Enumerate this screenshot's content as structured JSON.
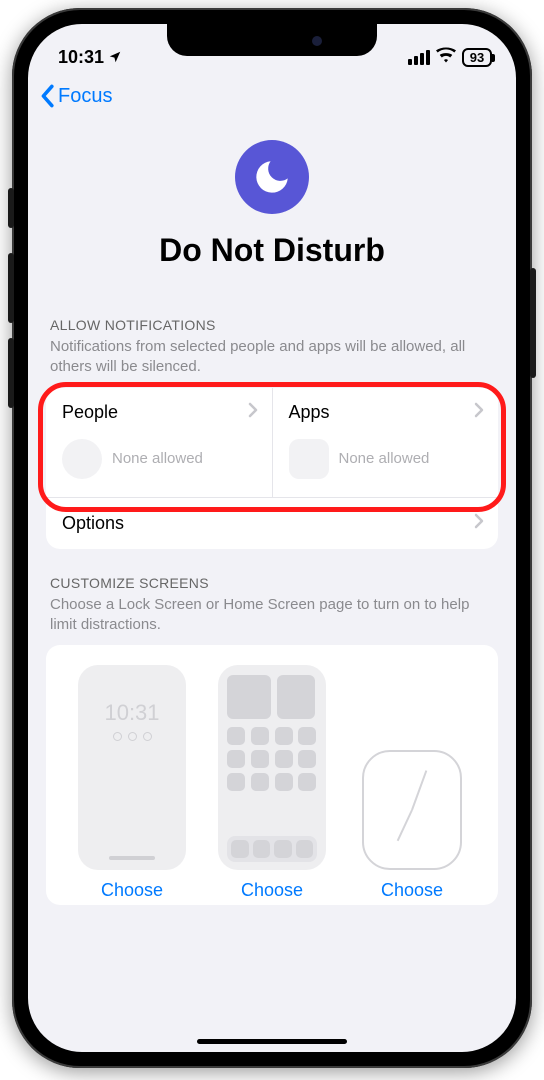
{
  "status": {
    "time": "10:31",
    "battery": "93"
  },
  "nav": {
    "back_label": "Focus"
  },
  "hero": {
    "title": "Do Not Disturb",
    "icon": "moon-icon"
  },
  "allow": {
    "header": "Allow Notifications",
    "description": "Notifications from selected people and apps will be allowed, all others will be silenced.",
    "people": {
      "title": "People",
      "status": "None allowed"
    },
    "apps": {
      "title": "Apps",
      "status": "None allowed"
    },
    "options_label": "Options"
  },
  "customize": {
    "header": "Customize Screens",
    "description": "Choose a Lock Screen or Home Screen page to turn on to help limit distractions.",
    "choose_label": "Choose",
    "lock_time": "10:31"
  },
  "colors": {
    "accent": "#5856d6",
    "link": "#007aff",
    "highlight": "#ff1a1a"
  }
}
